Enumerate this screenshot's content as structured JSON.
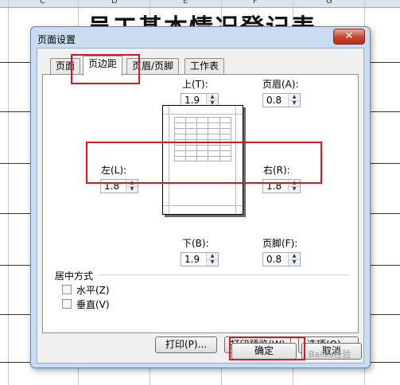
{
  "spreadsheet": {
    "columns": [
      "C",
      "D",
      "E",
      "F",
      "G"
    ],
    "title_text": "员工基本情况登记表"
  },
  "dialog": {
    "title": "页面设置",
    "close_glyph": "✕",
    "tabs": [
      {
        "label": "页面",
        "active": false
      },
      {
        "label": "页边距",
        "active": true
      },
      {
        "label": "页眉/页脚",
        "active": false
      },
      {
        "label": "工作表",
        "active": false
      }
    ],
    "margins": {
      "top": {
        "label": "上(T):",
        "value": "1.9"
      },
      "header": {
        "label": "页眉(A):",
        "value": "0.8"
      },
      "left": {
        "label": "左(L):",
        "value": "1.8"
      },
      "right": {
        "label": "右(R):",
        "value": "1.8"
      },
      "bottom": {
        "label": "下(B):",
        "value": "1.9"
      },
      "footer": {
        "label": "页脚(F):",
        "value": "0.8"
      }
    },
    "centering": {
      "title": "居中方式",
      "horizontal": {
        "label": "水平(Z)",
        "checked": false
      },
      "vertical": {
        "label": "垂直(V)",
        "checked": false
      }
    },
    "buttons": {
      "print": "打印(P)...",
      "print_preview": "打印预览(W)",
      "options": "选项(O)...",
      "ok": "确定",
      "cancel": "取消"
    },
    "highlight_color": "#e0141e"
  },
  "watermark": "Baidu经验"
}
